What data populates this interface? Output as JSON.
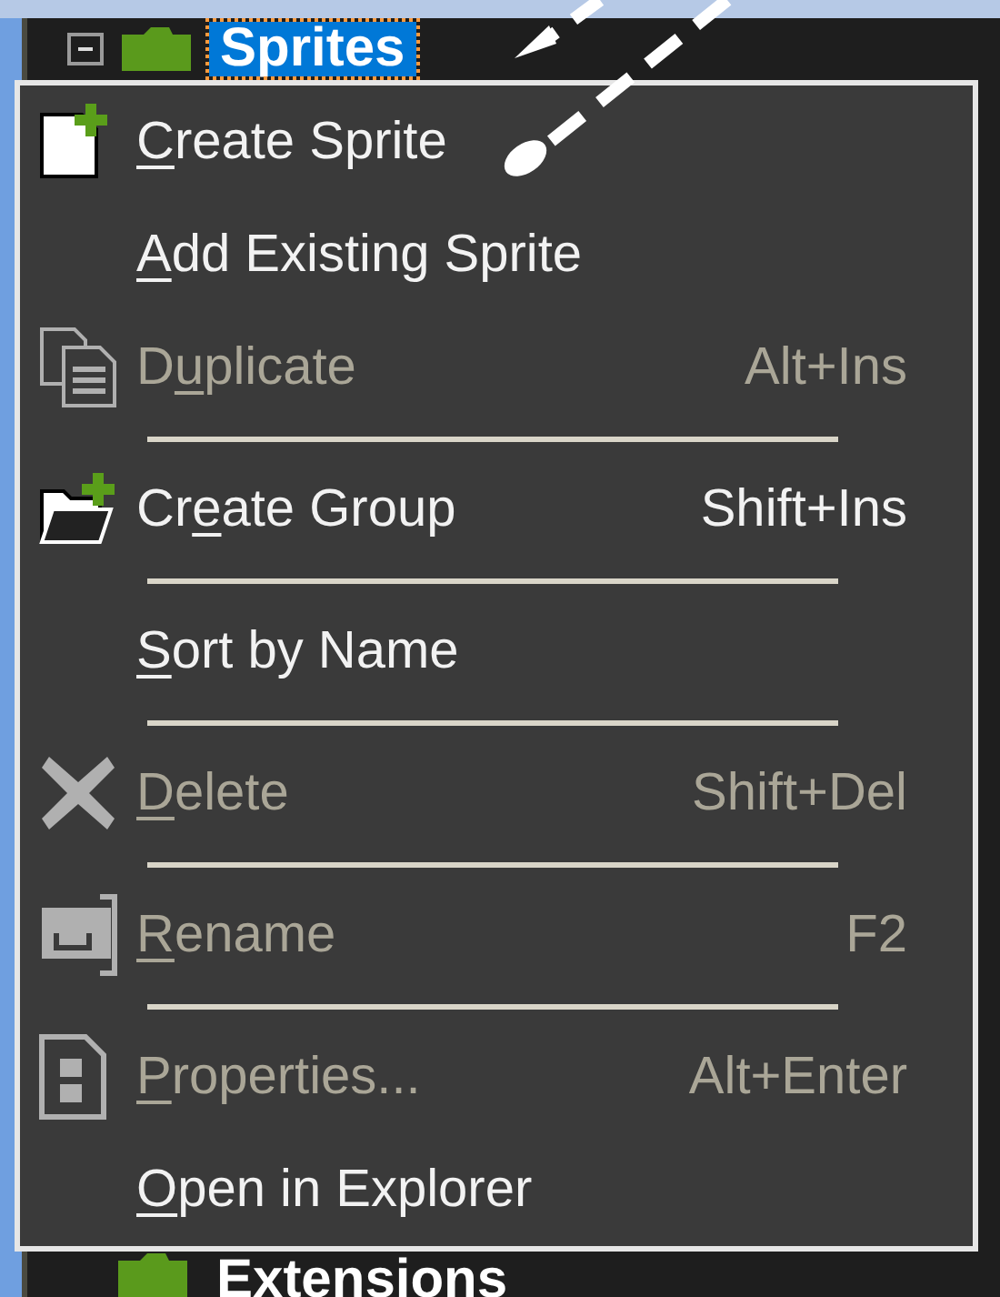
{
  "tree_items": [
    {
      "label": "Sprites",
      "selected": true,
      "expanded": true
    },
    {
      "label": "Extensions",
      "selected": false
    }
  ],
  "context_menu": [
    {
      "kind": "item",
      "key": "C",
      "after": "reate Sprite",
      "disabled": false
    },
    {
      "kind": "item",
      "key": "A",
      "after": "dd Existing Sprite",
      "disabled": false
    },
    {
      "kind": "item",
      "before": "D",
      "key": "u",
      "after": "plicate",
      "shortcut": "Alt+Ins",
      "disabled": true
    },
    {
      "kind": "separator"
    },
    {
      "kind": "item",
      "before": "Cr",
      "key": "e",
      "after": "ate Group",
      "shortcut": "Shift+Ins",
      "disabled": false
    },
    {
      "kind": "separator"
    },
    {
      "kind": "item",
      "key": "S",
      "after": "ort by Name",
      "disabled": false
    },
    {
      "kind": "separator"
    },
    {
      "kind": "item",
      "key": "D",
      "after": "elete",
      "shortcut": "Shift+Del",
      "disabled": true
    },
    {
      "kind": "separator"
    },
    {
      "kind": "item",
      "key": "R",
      "after": "ename",
      "shortcut": "F2",
      "disabled": true
    },
    {
      "kind": "separator"
    },
    {
      "kind": "item",
      "key": "P",
      "after": "roperties...",
      "shortcut": "Alt+Enter",
      "disabled": true
    },
    {
      "kind": "item",
      "key": "O",
      "after": "pen in Explorer",
      "disabled": false
    }
  ]
}
